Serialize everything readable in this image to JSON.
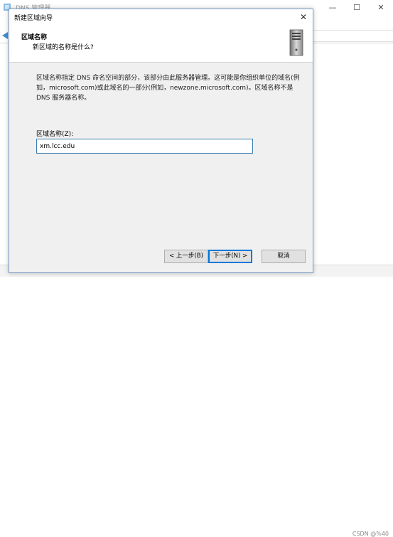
{
  "background_window": {
    "title": "DNS 管理器",
    "controls": {
      "minimize": "—",
      "maximize": "☐",
      "close": "✕"
    },
    "watermark": "CSDN @%40"
  },
  "dialog": {
    "title": "新建区域向导",
    "close_glyph": "✕",
    "header": {
      "title": "区域名称",
      "subtitle": "新区域的名称是什么?",
      "icon": "server-icon"
    },
    "description": "区域名称指定 DNS 命名空间的部分，该部分由此服务器管理。这可能是你组织单位的域名(例如，microsoft.com)或此域名的一部分(例如，newzone.microsoft.com)。区域名称不是 DNS 服务器名称。",
    "zone_name": {
      "label": "区域名称(Z):",
      "value": "xm.lcc.edu"
    },
    "buttons": {
      "back": "< 上一步(B)",
      "next": "下一步(N) >",
      "cancel": "取消"
    }
  },
  "colors": {
    "dialog_bg": "#f0f0f0",
    "header_bg": "#ffffff",
    "accent": "#0078d7",
    "input_border": "#3c7fb1"
  }
}
